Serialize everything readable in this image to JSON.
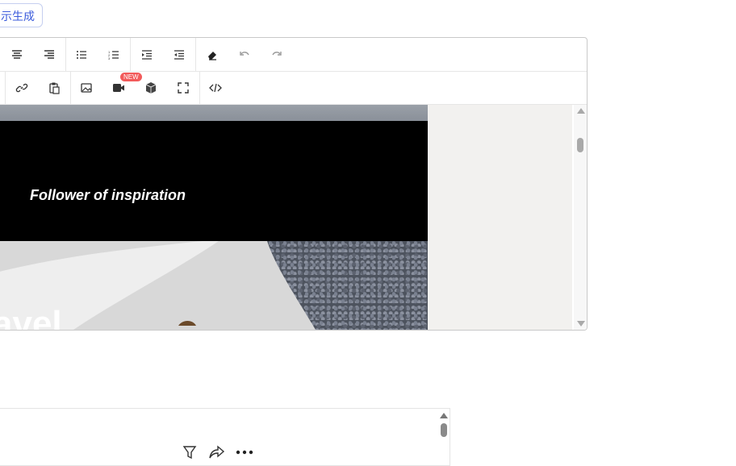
{
  "ai_button": {
    "label": "示生成"
  },
  "toolbar": {
    "row1": [
      {
        "name": "align-center-icon"
      },
      {
        "name": "align-right-icon"
      },
      {
        "name": "bulleted-list-icon"
      },
      {
        "name": "numbered-list-icon"
      },
      {
        "name": "indent-increase-icon"
      },
      {
        "name": "indent-decrease-icon"
      },
      {
        "name": "eraser-icon"
      },
      {
        "name": "undo-icon"
      },
      {
        "name": "redo-icon"
      }
    ],
    "row2": [
      {
        "name": "link-icon"
      },
      {
        "name": "paste-icon"
      },
      {
        "name": "image-icon"
      },
      {
        "name": "video-icon"
      },
      {
        "name": "cube-icon"
      },
      {
        "name": "fullscreen-icon"
      },
      {
        "name": "code-view-icon"
      }
    ],
    "video_badge": "NEW"
  },
  "content": {
    "tagline": "Follower of inspiration",
    "photo_text": "avel"
  },
  "colors": {
    "accent": "#3b5bdb",
    "badge": "#f25b5b",
    "editor_bg": "#f2f1ef"
  }
}
